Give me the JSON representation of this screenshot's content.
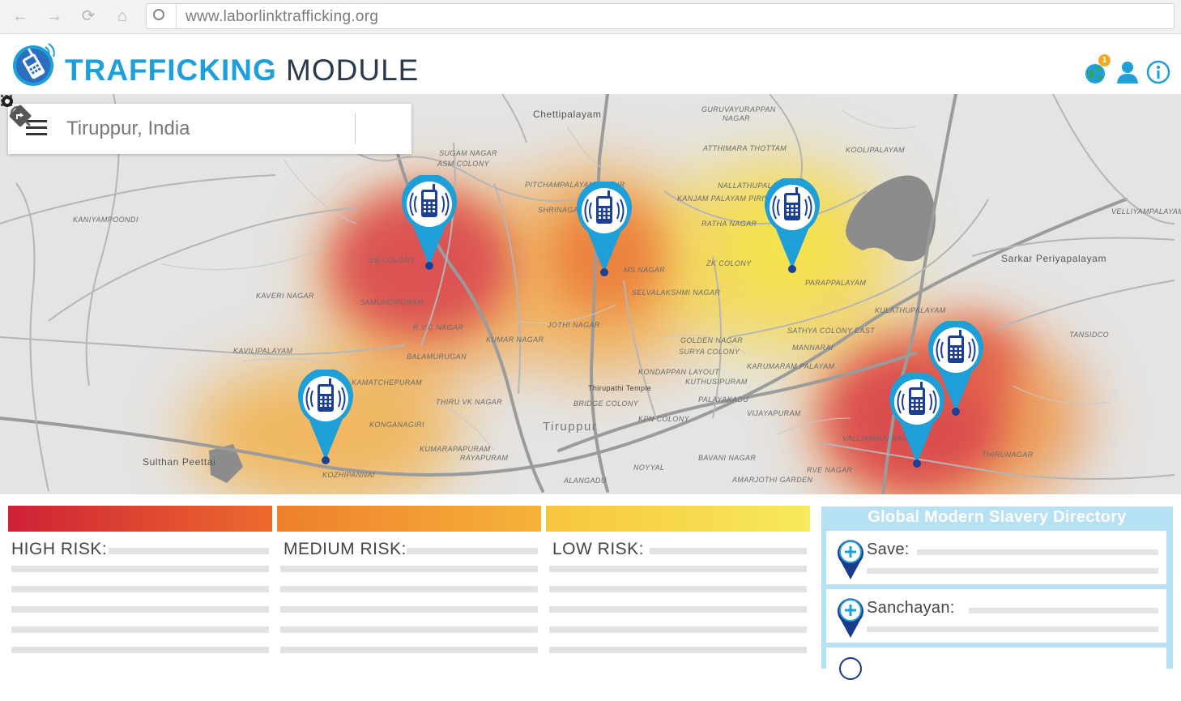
{
  "browser": {
    "url": "www.laborlinktrafficking.org",
    "nav_icons": [
      "back-arrow-icon",
      "forward-arrow-icon",
      "reload-icon",
      "home-icon"
    ]
  },
  "header": {
    "title_strong": "TRAFFICKING",
    "title_light": "MODULE",
    "logo_icon": "phone-signal-logo-icon",
    "notification_count": "1",
    "icons": [
      "globe-icon",
      "user-icon",
      "info-icon"
    ],
    "brand_color": "#1e9fd7"
  },
  "map": {
    "search_value": "Tiruppur, India",
    "places": {
      "chettipalayam": "Chettipalayam",
      "guruvayurappan": "GURUVAYURAPPAN",
      "nagar1": "NAGAR",
      "koolipalayam": "KOOLIPALAYAM",
      "velliyampalayam": "VELLIYAMPALAYAM",
      "kaniyampoondi": "KANIYAMPOONDI",
      "kaveri_nagar": "KAVERI NAGAR",
      "kavilipalayam": "KAVILIPALAYAM",
      "samundipuram": "SAMUNDIPURAM",
      "eb_colony": "EB COLONY",
      "rvc_nagar": "R.V.C NAGAR",
      "balamurugan": "BALAMURUGAN",
      "kumar_nagar": "KUMAR NAGAR",
      "kamatchepuram": "KAMATCHEPURAM",
      "konganagiri": "KONGANAGIRI",
      "kumarapapuram": "KUMARAPAPURAM",
      "rayapuram": "RAYAPURAM",
      "sulthan_peettai": "Sulthan Peettai",
      "kozhipannai": "KOZHIPANNAI",
      "tiruppur": "Tiruppur",
      "kpn_colony": "KPN COLONY",
      "bridge_colony": "BRIDGE COLONY",
      "kuthusipuram": "KUTHUSIPURAM",
      "palayakadu": "PALAYAKADU",
      "golden_nagar": "GOLDEN NAGAR",
      "surya_colony": "SURYA COLONY",
      "zk_colony": "ZK COLONY",
      "parappalayam": "PARAPPALAYAM",
      "sathya_colony": "SATHYA COLONY EAST",
      "mannarai": "MANNARAI",
      "kulathupalayam": "KULATHUPALAYAM",
      "sarkar": "Sarkar Periyapalayam",
      "tansidco": "TANSIDCO",
      "valliammai": "VALLIAMMAI NAGAR",
      "thirunagar": "THIRUNAGAR",
      "rve_nagar": "RVE NAGAR",
      "bavani_nagar": "BAVANI NAGAR",
      "noyyal": "NOYYAL",
      "amarjothi": "AMARJOTHI GARDEN",
      "alangadu": "ALANGADU",
      "kanjam": "KANJAM PALAYAM PIRIVU",
      "ratha_nagar": "RATHA NAGAR",
      "thottam": "ATTHIMARA THOTTAM",
      "nallathupalayam": "NALLATHUPALAYAM",
      "pichampalayam": "PITCHAMPALAYAM PUDUR",
      "shrinagar": "SHRINAGAR",
      "ms_nagar": "MS NAGAR",
      "selvalakshmi": "SELVALAKSHMI NAGAR",
      "jothi_nagar": "JOTHI NAGAR",
      "thiruvk": "THIRU VK NAGAR",
      "thirupathi": "Thirupathi Temple",
      "kondappan": "KONDAPPAN LAYOUT",
      "karumaram": "KARUMARAM PALAYAM",
      "vijayapuram": "VIJAYAPURAM",
      "sugam_nagar": "SUGAM NAGAR",
      "asm_colony": "ASM COLONY"
    },
    "marker_count": 6,
    "marker_icon": "phone-signal-pin-icon"
  },
  "risk": {
    "high": {
      "label": "HIGH RISK:",
      "color_start": "#cf2036",
      "color_end": "#ec6b2d"
    },
    "medium": {
      "label": "MEDIUM RISK:",
      "color_start": "#ee7f2c",
      "color_end": "#f6b33a"
    },
    "low": {
      "label": "LOW RISK:",
      "color_start": "#f7c53d",
      "color_end": "#f7ea5c"
    }
  },
  "directory": {
    "title": "Global Modern Slavery Directory",
    "items": [
      {
        "name": "Save:"
      },
      {
        "name": "Sanchayan:"
      }
    ],
    "accent": "#b6e0f3"
  }
}
